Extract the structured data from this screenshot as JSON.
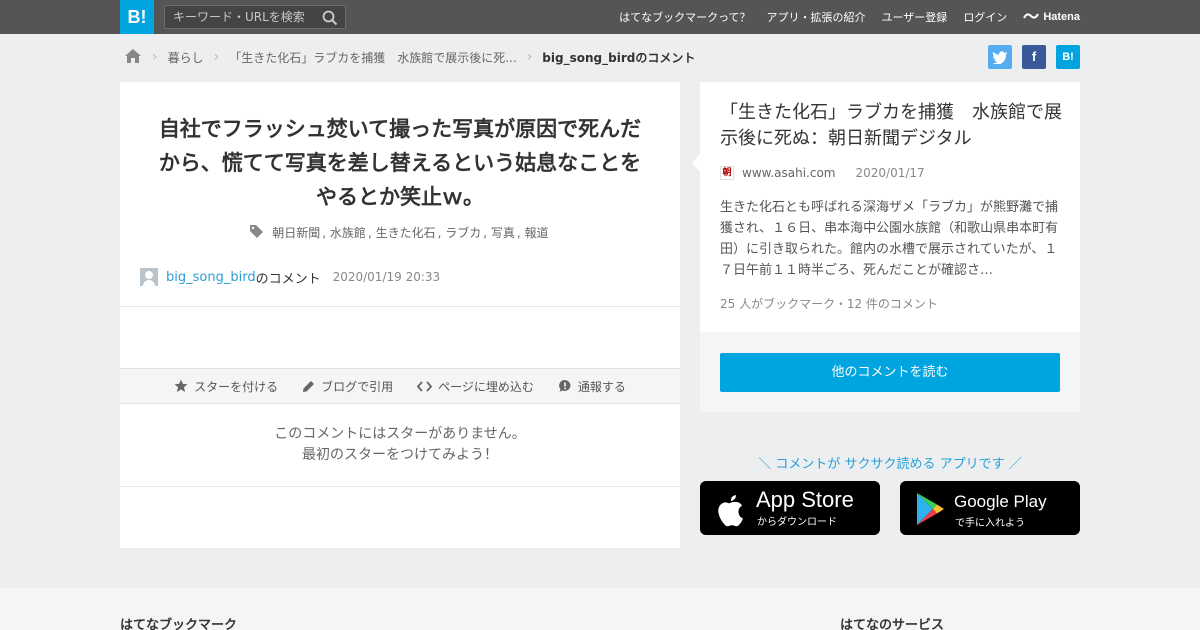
{
  "header": {
    "logo": "B!",
    "search_placeholder": "キーワード・URLを検索",
    "nav": [
      "はてなブックマークって？",
      "アプリ・拡張の紹介",
      "ユーザー登録",
      "ログイン"
    ],
    "brand": "Hatena"
  },
  "breadcrumb": {
    "items": [
      "暮らし",
      "「生きた化石」ラブカを捕獲　水族館で展示後に死...",
      "big_song_birdのコメント"
    ]
  },
  "share": {
    "hatena_label": "B!"
  },
  "comment": {
    "text": "自社でフラッシュ焚いて撮った写真が原因で死んだから、慌てて写真を差し替えるという姑息なことをやるとか笑止ｗ。",
    "tags": [
      "朝日新聞",
      "水族館",
      "生きた化石",
      "ラブカ",
      "写真",
      "報道"
    ],
    "user": "big_song_bird",
    "user_suffix": "のコメント",
    "timestamp": "2020/01/19 20:33"
  },
  "actions": [
    "スターを付ける",
    "ブログで引用",
    "ページに埋め込む",
    "通報する"
  ],
  "no_star": {
    "line1": "このコメントにはスターがありません。",
    "line2": "最初のスターをつけてみよう！"
  },
  "entry": {
    "title": "「生きた化石」ラブカを捕獲　水族館で展示後に死ぬ：朝日新聞デジタル",
    "favicon": "朝",
    "domain": "www.asahi.com",
    "date": "2020/01/17",
    "summary": "生きた化石とも呼ばれる深海ザメ「ラブカ」が熊野灘で捕獲され、１６日、串本海中公園水族館（和歌山県串本町有田）に引き取られた。館内の水槽で展示されていたが、１７日午前１１時半ごろ、死んだことが確認さ…",
    "counts": "25 人がブックマーク・12 件のコメント",
    "read_more": "他のコメントを読む"
  },
  "apps": {
    "promo": "＼ コメントが サクサク読める アプリです ／",
    "apple_big": "App Store",
    "apple_small": "からダウンロード",
    "google_big": "Google Play",
    "google_small": "で手に入れよう"
  },
  "footer": {
    "left_heading": "はてなブックマーク",
    "right_heading": "はてなのサービス"
  },
  "colors": {
    "accent": "#00a4de",
    "link": "#2a9fd6",
    "topbar": "#555555"
  }
}
